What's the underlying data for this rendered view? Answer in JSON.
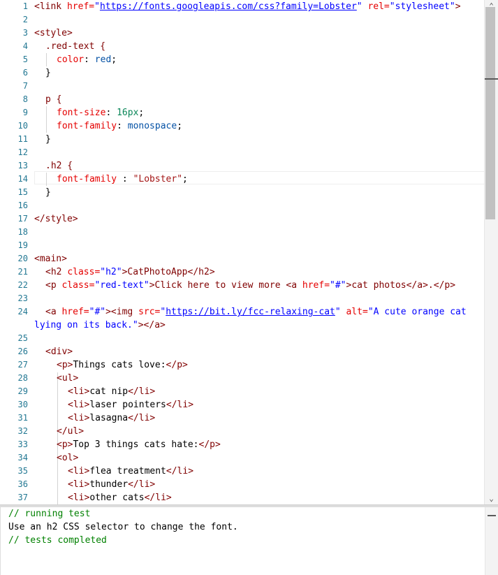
{
  "editor": {
    "line_numbers": [
      "1",
      "2",
      "3",
      "4",
      "5",
      "6",
      "7",
      "8",
      "9",
      "10",
      "11",
      "12",
      "13",
      "14",
      "15",
      "16",
      "17",
      "18",
      "19",
      "20",
      "21",
      "22",
      "23",
      "24",
      "25",
      "26",
      "27",
      "28",
      "29",
      "30",
      "31",
      "32",
      "33",
      "34",
      "35",
      "36",
      "37"
    ],
    "lines": {
      "l1": {
        "a": "<link ",
        "b": "href=",
        "c": "\"",
        "d": "https://fonts.googleapis.com/css?family=Lobster",
        "e": "\" ",
        "f": "rel=",
        "g": "\"stylesheet\"",
        "h": ">"
      },
      "l3": "<style>",
      "l4": ".red-text {",
      "l5": {
        "p": "color",
        "c": ": ",
        "v": "red",
        "s": ";"
      },
      "l6": "}",
      "l8": "p {",
      "l9": {
        "p": "font-size",
        "c": ": ",
        "v": "16px",
        "s": ";"
      },
      "l10": {
        "p": "font-family",
        "c": ": ",
        "v": "monospace",
        "s": ";"
      },
      "l11": "}",
      "l13": ".h2 {",
      "l14": {
        "p": "font-family",
        "c": " : ",
        "v": "\"Lobster\"",
        "s": ";"
      },
      "l15": "}",
      "l17": "</style>",
      "l20": "<main>",
      "l21": {
        "a": "<h2 ",
        "b": "class=",
        "c": "\"h2\"",
        "d": ">CatPhotoApp</h2>"
      },
      "l22": {
        "a": "<p ",
        "b": "class=",
        "c": "\"red-text\"",
        "d": ">Click here to view more ",
        "e": "<a ",
        "f": "href=",
        "g": "\"#\"",
        "h": ">cat photos</a>.</p>"
      },
      "l24a": {
        "a": "<a ",
        "b": "href=",
        "c": "\"#\"",
        "d": "><img ",
        "e": "src=",
        "f": "\"",
        "g": "https://bit.ly/fcc-relaxing-cat",
        "h": "\" ",
        "i": "alt=",
        "j": "\"A cute orange cat"
      },
      "l24b": {
        "a": "lying on its back.\"",
        "b": "></a>"
      },
      "l26": "<div>",
      "l27": {
        "a": "<p>",
        "b": "Things cats love:",
        "c": "</p>"
      },
      "l28": "<ul>",
      "l29": {
        "a": "<li>",
        "b": "cat nip",
        "c": "</li>"
      },
      "l30": {
        "a": "<li>",
        "b": "laser pointers",
        "c": "</li>"
      },
      "l31": {
        "a": "<li>",
        "b": "lasagna",
        "c": "</li>"
      },
      "l32": "</ul>",
      "l33": {
        "a": "<p>",
        "b": "Top 3 things cats hate:",
        "c": "</p>"
      },
      "l34": "<ol>",
      "l35": {
        "a": "<li>",
        "b": "flea treatment",
        "c": "</li>"
      },
      "l36": {
        "a": "<li>",
        "b": "thunder",
        "c": "</li>"
      },
      "l37": {
        "a": "<li>",
        "b": "other cats",
        "c": "</li>"
      }
    }
  },
  "scrollbar": {
    "up_icon": "chevron-up-icon",
    "down_icon": "chevron-down-icon",
    "up_glyph": "⌃",
    "down_glyph": "⌄"
  },
  "console": {
    "lines": [
      "// running test",
      "Use an h2 CSS selector to change the font.",
      "// tests completed"
    ],
    "collapse_glyph": "—"
  },
  "colors": {
    "tag": "#800000",
    "attribute": "#e50000",
    "string": "#0000ff",
    "number": "#098658",
    "comment": "#008000",
    "gutter": "#237893"
  }
}
